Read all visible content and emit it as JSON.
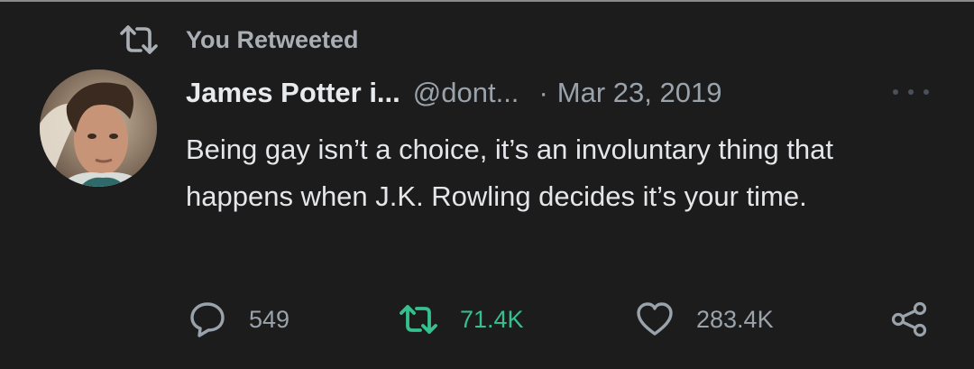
{
  "context": {
    "label": "You Retweeted",
    "icon": "retweet-icon"
  },
  "tweet": {
    "display_name": "James Potter i...",
    "handle": "@dont...",
    "separator": "·",
    "date": "Mar 23, 2019",
    "text": "Being gay isn’t a choice, it’s an involuntary thing that happens when J.K. Rowling decides it’s your time."
  },
  "actions": {
    "reply_count": "549",
    "retweet_count": "71.4K",
    "like_count": "283.4K"
  },
  "colors": {
    "background": "#1c1c1c",
    "retweeted_accent": "#36c08f",
    "muted": "#9aa3ab",
    "text": "#e4e6e9"
  }
}
